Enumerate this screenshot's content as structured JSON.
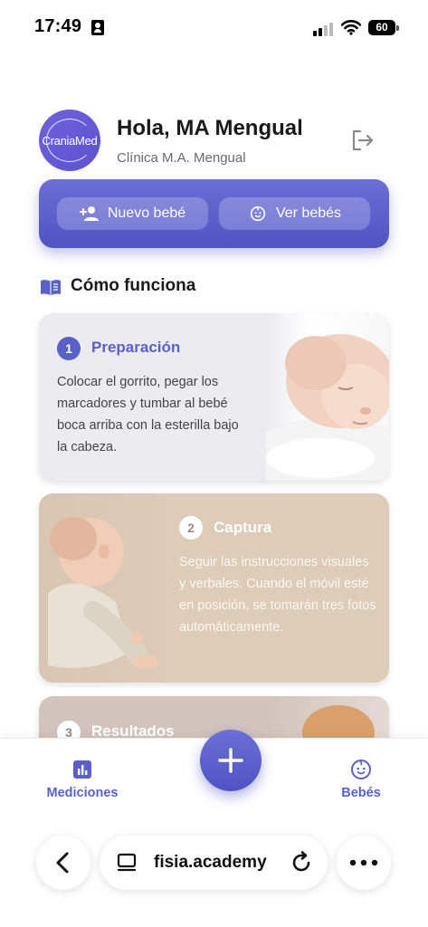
{
  "status_bar": {
    "time": "17:49",
    "battery": "60"
  },
  "header": {
    "avatar_text": "CraniaMed",
    "greeting": "Hola, MA Mengual",
    "clinic": "Clínica M.A. Mengual"
  },
  "actions": {
    "new_baby": "Nuevo bebé",
    "view_babies": "Ver bebés"
  },
  "section": {
    "title": "Cómo funciona"
  },
  "steps": [
    {
      "number": "1",
      "title": "Preparación",
      "description": "Colocar el gorrito, pegar los marcadores y tumbar al bebé boca arriba con la esterilla bajo la cabeza."
    },
    {
      "number": "2",
      "title": "Captura",
      "description": "Seguir las instrucciones visuales y verbales. Cuando el móvil esté en posición, se tomarán tres fotos automáticamente."
    },
    {
      "number": "3",
      "title": "Resultados"
    }
  ],
  "bottom_nav": {
    "measurements": "Mediciones",
    "babies": "Bebés"
  },
  "browser": {
    "url": "fisia.academy"
  },
  "colors": {
    "accent": "#5961c9",
    "card1": "#ebebf0",
    "card2": "#ddccb8",
    "card3": "#d2c4bc"
  }
}
